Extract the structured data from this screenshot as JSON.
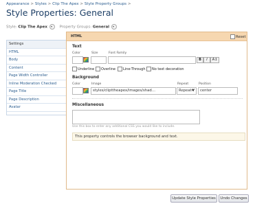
{
  "breadcrumb": [
    "Appearance",
    "Styles",
    "Clip The Apex",
    "Style Property Groups"
  ],
  "breadcrumb_sep": ">",
  "page_title": "Style Properties: General",
  "filters": {
    "style_label": "Style:",
    "style_value": "Clip The Apex",
    "group_label": "Property Groups:",
    "group_value": "General"
  },
  "sidebar": {
    "header": "Settings",
    "items": [
      "HTML",
      "Body",
      "Content",
      "Page Width Controller",
      "Inline Moderation Checked",
      "Page Title",
      "Page Description",
      "Avatar"
    ]
  },
  "panel": {
    "title": "HTML",
    "reset_label": "Reset",
    "text": {
      "heading": "Text",
      "color_label": "Color",
      "size_label": "Size",
      "font_family_label": "Font Family",
      "bold_label": "B",
      "italic_label": "I",
      "size_adjust_label": "A↕",
      "underline_label": "Underline",
      "overline_label": "Overline",
      "linethrough_label": "Line-Through",
      "nodecoration_label": "No text decoration"
    },
    "background": {
      "heading": "Background",
      "color_label": "Color",
      "image_label": "Image",
      "image_value": "styles/clipttheapex/images/shad…",
      "repeat_label": "Repeat",
      "repeat_value": "Repeat-Y",
      "position_label": "Position",
      "position_value": "center"
    },
    "misc": {
      "heading": "Miscellaneous",
      "hint": "Use this box to enter any additional CSS you would like to include."
    },
    "description": "This property controls the browser background and text."
  },
  "actions": {
    "update_label": "Update Style Properties",
    "undo_label": "Undo Changes"
  },
  "colors": {
    "panel_header": "#f6d7b0",
    "panel_border": "#e0b98a",
    "link": "#2b5d8f",
    "title": "#1d3f66"
  }
}
